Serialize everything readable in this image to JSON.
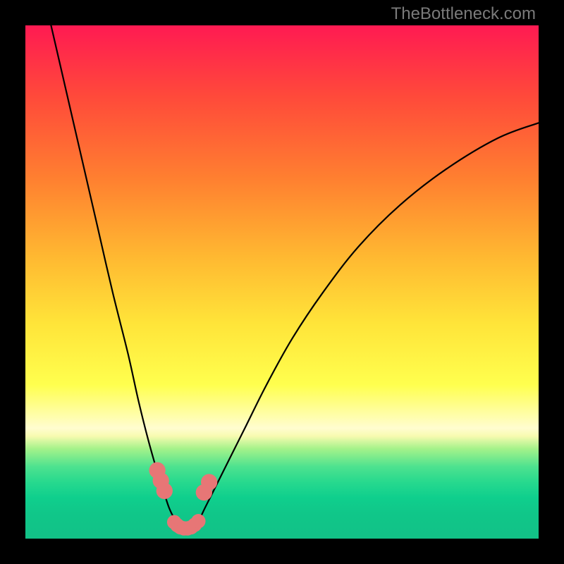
{
  "watermark": "TheBottleneck.com",
  "chart_data": {
    "type": "line",
    "title": "",
    "xlabel": "",
    "ylabel": "",
    "xlim": [
      0,
      100
    ],
    "ylim": [
      0,
      100
    ],
    "series": [
      {
        "name": "bottleneck-curve",
        "x": [
          5,
          8,
          11,
          14,
          17,
          20,
          22,
          24,
          26,
          27,
          28,
          29,
          30,
          31,
          32,
          33,
          34,
          35,
          37,
          40,
          43,
          47,
          52,
          58,
          65,
          73,
          82,
          92,
          100
        ],
        "y": [
          100,
          87,
          74,
          61,
          48,
          36,
          27,
          19,
          12,
          9,
          6,
          4,
          3,
          2,
          2,
          3,
          4,
          6,
          10,
          16,
          22,
          30,
          39,
          48,
          57,
          65,
          72,
          78,
          81
        ]
      }
    ],
    "markers": [
      {
        "name": "left-upper-dot-1",
        "x": 25.7,
        "y": 13.3,
        "r": 1.6
      },
      {
        "name": "left-upper-dot-2",
        "x": 26.4,
        "y": 11.3,
        "r": 1.6
      },
      {
        "name": "left-upper-dot-3",
        "x": 27.1,
        "y": 9.3,
        "r": 1.6
      },
      {
        "name": "right-upper-dot-1",
        "x": 34.8,
        "y": 9.0,
        "r": 1.6
      },
      {
        "name": "right-upper-dot-2",
        "x": 35.8,
        "y": 11.0,
        "r": 1.6
      },
      {
        "name": "bottom-dot-1",
        "x": 29.0,
        "y": 3.2,
        "r": 1.4
      },
      {
        "name": "bottom-dot-2",
        "x": 29.6,
        "y": 2.6,
        "r": 1.4
      },
      {
        "name": "bottom-dot-3",
        "x": 30.2,
        "y": 2.2,
        "r": 1.4
      },
      {
        "name": "bottom-dot-4",
        "x": 30.9,
        "y": 2.0,
        "r": 1.4
      },
      {
        "name": "bottom-dot-5",
        "x": 31.6,
        "y": 2.0,
        "r": 1.4
      },
      {
        "name": "bottom-dot-6",
        "x": 32.3,
        "y": 2.2,
        "r": 1.4
      },
      {
        "name": "bottom-dot-7",
        "x": 33.0,
        "y": 2.7,
        "r": 1.4
      },
      {
        "name": "bottom-dot-8",
        "x": 33.7,
        "y": 3.4,
        "r": 1.4
      }
    ],
    "colors": {
      "curve": "#000000",
      "marker": "#e77676",
      "gradient_top": "#ff1a52",
      "gradient_mid": "#ffe439",
      "gradient_green": "#27d98e"
    }
  }
}
